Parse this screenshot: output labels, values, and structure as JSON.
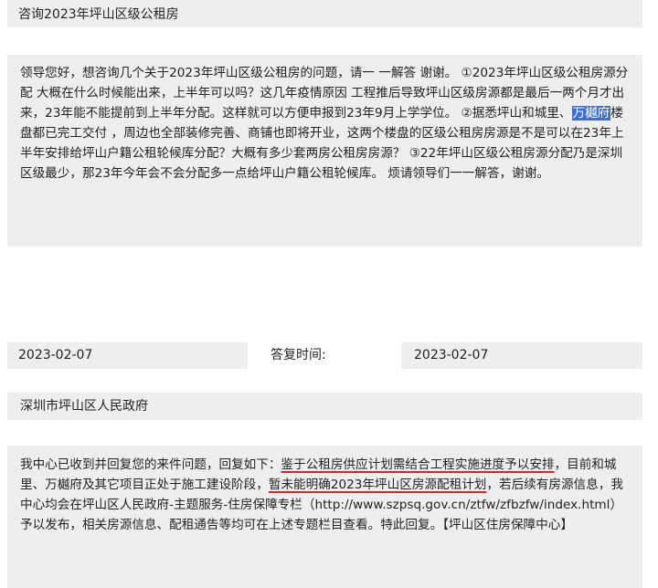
{
  "title": "咨询2023年坪山区级公租房",
  "question": {
    "part1": "领导您好，想咨询几个关于2023年坪山区级公租房的问题，请一 一解答 谢谢。 ①2023年坪山区级公租房源分配 大概在什么时候能出来，上半年可以吗？这几年疫情原因 工程推后导致坪山区级房源都是最后一两个月才出来，23年能不能提前到上半年分配。这样就可以方便申报到23年9月上学学位。 ②据悉坪山和城里、",
    "highlight": "万樾府",
    "part2": "楼盘都已完工交付 ，周边也全部装修完善、商铺也即将开业，这两个楼盘的区级公租房房源是不是可以在23年上半年安排给坪山户籍公租轮候库分配？大概有多少套两房公租房房源？ ③22年坪山区级公租房源分配乃是深圳区级最少，那23年今年会不会分配多一点给坪山户籍公租轮候库。 烦请领导们一一解答，谢谢。"
  },
  "submit_date": "2023-02-07",
  "reply_time_label": "答复时间:",
  "reply_date": "2023-02-07",
  "organization": "深圳市坪山区人民政府",
  "answer": {
    "part1": "我中心已收到并回复您的来件问题，回复如下：",
    "underline1": "鉴于公租房供应计划需结合工程实施进度予以安排",
    "part2": "，目前和城里、万樾府及其它项目正处于施工建设阶段，",
    "underline2": "暂未能明确2023年坪山区房源配租计划",
    "part3": "，若后续有房源信息，我中心均会在坪山区人民政府-主题服务-住房保障专栏（http://www.szpsq.gov.cn/ztfw/zfbzfw/index.html）予以发布，相关房源信息、配租通告等均可在上述专题栏目查看。特此回复。【坪山区住房保障中心】"
  },
  "colors": {
    "box_background": "#eeeeee",
    "highlight": "#3b6fd6",
    "underline": "#d7262a"
  }
}
